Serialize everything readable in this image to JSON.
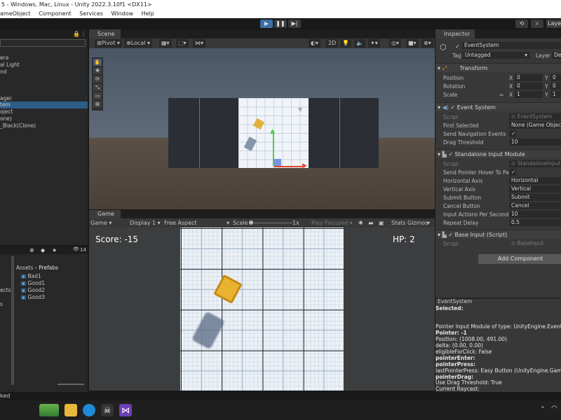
{
  "window": {
    "title": "5 - Windows, Mac, Linux - Unity 2022.3.10f1 <DX11>"
  },
  "menu": [
    "ameObject",
    "Component",
    "Services",
    "Window",
    "Help"
  ],
  "toolbar": {
    "play": "▶",
    "pause": "❚❚",
    "step": "▶|",
    "layers_label": "Layers"
  },
  "hierarchy": {
    "rows": [
      "era",
      "al Light",
      "nd",
      "ager",
      "tem",
      "oject",
      "one)",
      "_Black(Clone)"
    ],
    "selected_index": 4
  },
  "project": {
    "breadcrumb": [
      "Assets",
      "Prefabs"
    ],
    "count": "14",
    "left_rows": [
      "ects",
      "s"
    ],
    "prefabs": [
      "Bad1",
      "Good1",
      "Good2",
      "Good3"
    ]
  },
  "scene": {
    "tab_label": "Scene",
    "pivot_label": "Pivot",
    "local_label": "Local",
    "mode_2d": "2D"
  },
  "game": {
    "tab_label": "Game",
    "mode_dropdown": "Game",
    "display_dropdown": "Display 1",
    "aspect_dropdown": "Free Aspect",
    "scale_label": "Scale",
    "scale_value": "1x",
    "play_focused": "Play Focused",
    "stats_label": "Stats",
    "gizmos_label": "Gizmos",
    "score_text": "Score: -15",
    "hp_text": "HP: 2"
  },
  "inspector": {
    "tab_label": "Inspector",
    "object_name": "EventSystem",
    "tag_label": "Tag",
    "tag_value": "Untagged",
    "layer_label": "Layer",
    "layer_value": "De",
    "transform": {
      "title": "Transform",
      "position_label": "Position",
      "rotation_label": "Rotation",
      "scale_label": "Scale",
      "x": "X",
      "y": "Y",
      "pos_x": "0",
      "pos_y": "0",
      "rot_x": "0",
      "rot_y": "0",
      "scale_x": "1",
      "scale_y": "1"
    },
    "event_system": {
      "title": "Event System",
      "script_label": "Script",
      "script_value": "EventSystem",
      "first_selected_label": "First Selected",
      "first_selected_value": "None (Game Object)",
      "send_nav_label": "Send Navigation Events",
      "send_nav_value": "✓",
      "drag_threshold_label": "Drag Threshold",
      "drag_threshold_value": "10"
    },
    "standalone": {
      "title": "Standalone Input Module",
      "script_label": "Script",
      "script_value": "StandaloneInputMo",
      "hover_label": "Send Pointer Hover To Pare",
      "hover_value": "✓",
      "h_axis_label": "Horizontal Axis",
      "h_axis_value": "Horizontal",
      "v_axis_label": "Vertical Axis",
      "v_axis_value": "Vertical",
      "submit_label": "Submit Button",
      "submit_value": "Submit",
      "cancel_label": "Cancel Button",
      "cancel_value": "Cancel",
      "actions_label": "Input Actions Per Second",
      "actions_value": "10",
      "repeat_label": "Repeat Delay",
      "repeat_value": "0.5"
    },
    "base_input": {
      "title": "Base Input (Script)",
      "script_label": "Script",
      "script_value": "BaseInput"
    },
    "add_component": "Add Component"
  },
  "eventsystem_panel": {
    "header": "EventSystem",
    "selected": "Selected:",
    "module_line": "Pointer Input Module of type: UnityEngine.EventSyst",
    "pointer": "Pointer: -1",
    "position": "Position: (1008.00, 491.00)",
    "delta": "delta: (0.00, 0.00)",
    "eligible": "eligibleForClick: False",
    "enter": "pointerEnter:",
    "press": "pointerPress:",
    "last_press": "lastPointerPress: Easy Button (UnityEngine.GameOb",
    "drag": "pointerDrag:",
    "use_drag": "Use Drag Threshold: True",
    "current_raycast": "Current Raycast:"
  },
  "status": {
    "text": "ked"
  }
}
